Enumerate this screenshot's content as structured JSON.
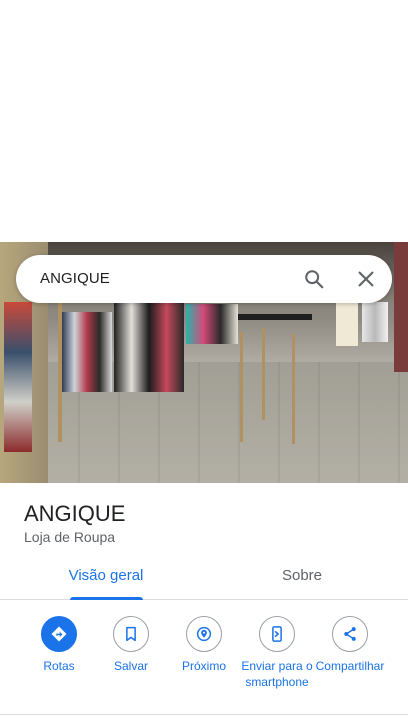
{
  "search": {
    "query": "ANGIQUE"
  },
  "place": {
    "name": "ANGIQUE",
    "category": "Loja de Roupa"
  },
  "tabs": [
    {
      "label": "Visão geral",
      "active": true
    },
    {
      "label": "Sobre",
      "active": false
    }
  ],
  "actions": [
    {
      "label": "Rotas",
      "icon": "directions-icon"
    },
    {
      "label": "Salvar",
      "icon": "bookmark-icon"
    },
    {
      "label": "Próximo",
      "icon": "nearby-icon"
    },
    {
      "label": "Enviar para o smartphone",
      "icon": "send-to-phone-icon"
    },
    {
      "label": "Compartilhar",
      "icon": "share-icon"
    }
  ],
  "colors": {
    "accent": "#1a73e8",
    "text": "#202124",
    "secondary_text": "#5f6368",
    "divider": "#dadce0"
  }
}
